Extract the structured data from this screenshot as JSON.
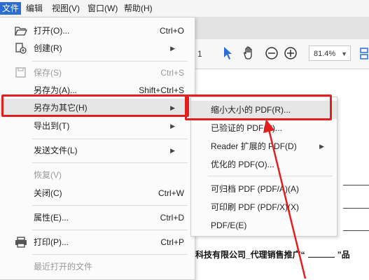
{
  "menubar": {
    "items": [
      "文件",
      "编辑",
      "视图(V)",
      "窗口(W)",
      "帮助(H)"
    ]
  },
  "toolbar": {
    "page_num": "1",
    "zoom": "81.4%"
  },
  "file_menu": {
    "items": [
      {
        "label": "打开(O)...",
        "shortcut": "Ctrl+O",
        "icon": "folder-open-icon"
      },
      {
        "label": "创建(R)",
        "submenu": true,
        "icon": "create-pdf-icon"
      },
      {
        "label": "保存(S)",
        "shortcut": "Ctrl+S",
        "icon": "save-icon",
        "disabled": true
      },
      {
        "label": "另存为(A)...",
        "shortcut": "Shift+Ctrl+S"
      },
      {
        "label": "另存为其它(H)",
        "submenu": true,
        "highlighted": true
      },
      {
        "label": "导出到(T)",
        "submenu": true
      },
      {
        "label": "发送文件(L)",
        "submenu": true
      },
      {
        "label": "恢复(V)",
        "disabled": true
      },
      {
        "label": "关闭(C)",
        "shortcut": "Ctrl+W"
      },
      {
        "label": "属性(E)...",
        "shortcut": "Ctrl+D"
      },
      {
        "label": "打印(P)...",
        "shortcut": "Ctrl+P",
        "icon": "printer-icon"
      },
      {
        "label": "最近打开的文件",
        "disabled": true
      }
    ]
  },
  "save_as_other_submenu": {
    "items": [
      {
        "label": "缩小大小的 PDF(R)...",
        "highlighted": true
      },
      {
        "label": "已验证的 PDF(C)..."
      },
      {
        "label": "Reader 扩展的 PDF(D)",
        "submenu": true
      },
      {
        "label": "优化的 PDF(O)..."
      },
      {
        "label": "可归档 PDF (PDF/A)(A)"
      },
      {
        "label": "可印刷 PDF (PDF/X)(X)"
      },
      {
        "label": "PDF/E(E)"
      }
    ]
  },
  "document": {
    "visible_text": "科技有限公司_代理销售推广“",
    "visible_text_end": "”品"
  },
  "colors": {
    "accent": "#2b6dd2",
    "annotation_red": "#e21f1f"
  }
}
